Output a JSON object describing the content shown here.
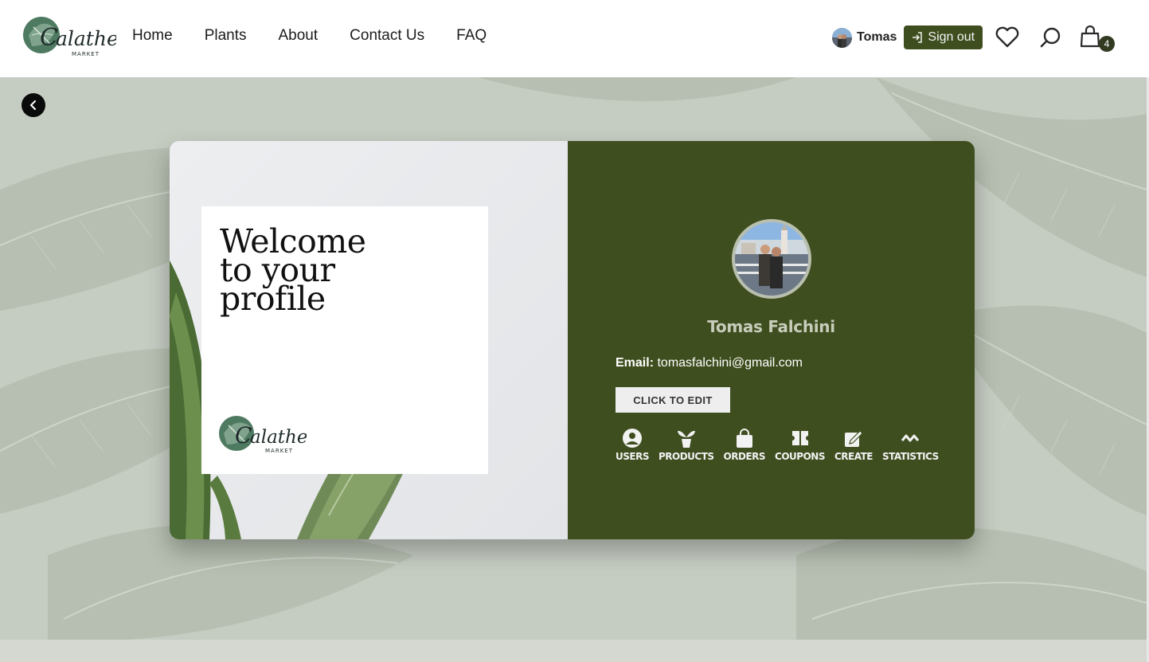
{
  "brand": {
    "logo_main": "Calathea",
    "logo_sub": "MARKET"
  },
  "nav": {
    "links": [
      "Home",
      "Plants",
      "About",
      "Contact Us",
      "FAQ"
    ]
  },
  "user": {
    "name": "Tomas",
    "signout_label": "Sign out"
  },
  "header_icons": {
    "favorites": "heart-icon",
    "search": "search-icon",
    "cart": "shopping-bag-icon",
    "cart_count": "4"
  },
  "profile_card": {
    "welcome_lines": [
      "Welcome",
      "to your",
      "profile"
    ],
    "full_name": "Tomas Falchini",
    "email_label": "Email:",
    "email": "tomasfalchini@gmail.com",
    "edit_label": "CLICK TO EDIT",
    "admin_items": [
      {
        "label": "USERS",
        "icon": "user-circle-icon"
      },
      {
        "label": "PRODUCTS",
        "icon": "plant-icon"
      },
      {
        "label": "ORDERS",
        "icon": "shopping-bag-icon"
      },
      {
        "label": "COUPONS",
        "icon": "ticket-icon"
      },
      {
        "label": "CREATE",
        "icon": "edit-icon"
      },
      {
        "label": "STATISTICS",
        "icon": "activity-icon"
      }
    ]
  },
  "colors": {
    "brand_green": "#3f4e1f",
    "background": "#c7cdc4",
    "name_text": "#c7ccbb"
  }
}
